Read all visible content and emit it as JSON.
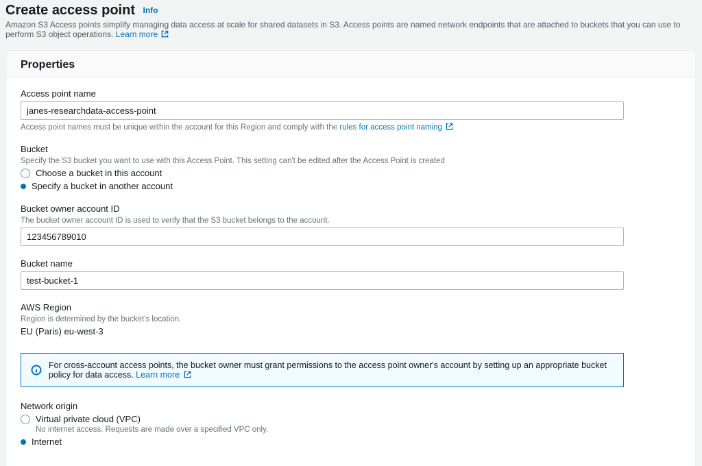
{
  "header": {
    "title": "Create access point",
    "info_link": "Info",
    "description": "Amazon S3 Access points simplify managing data access at scale for shared datasets in S3. Access points are named network endpoints that are attached to buckets that you can use to perform S3 object operations.",
    "learn_more": "Learn more"
  },
  "panel": {
    "title": "Properties",
    "access_point_name": {
      "label": "Access point name",
      "value": "janes-researchdata-access-point",
      "hint_pre": "Access point names must be unique within the account for this Region and comply with the ",
      "hint_link": "rules for access point naming"
    },
    "bucket": {
      "label": "Bucket",
      "hint": "Specify the S3 bucket you want to use with this Access Point. This setting can't be edited after the Access Point is created",
      "option_this_account": "Choose a bucket in this account",
      "option_other_account": "Specify a bucket in another account"
    },
    "owner_id": {
      "label": "Bucket owner account ID",
      "hint": "The bucket owner account ID is used to verify that the S3 bucket belongs to the account.",
      "value": "123456789010"
    },
    "bucket_name": {
      "label": "Bucket name",
      "value": "test-bucket-1"
    },
    "region": {
      "label": "AWS Region",
      "hint": "Region is determined by the bucket's location.",
      "value": "EU (Paris) eu-west-3"
    },
    "alert": {
      "text": "For cross-account access points, the bucket owner must grant permissions to the access point owner's account by setting up an appropriate bucket policy for data access.",
      "learn_more": "Learn more"
    },
    "network_origin": {
      "label": "Network origin",
      "option_vpc": "Virtual private cloud (VPC)",
      "option_vpc_sub": "No internet access. Requests are made over a specified VPC only.",
      "option_internet": "Internet"
    }
  }
}
